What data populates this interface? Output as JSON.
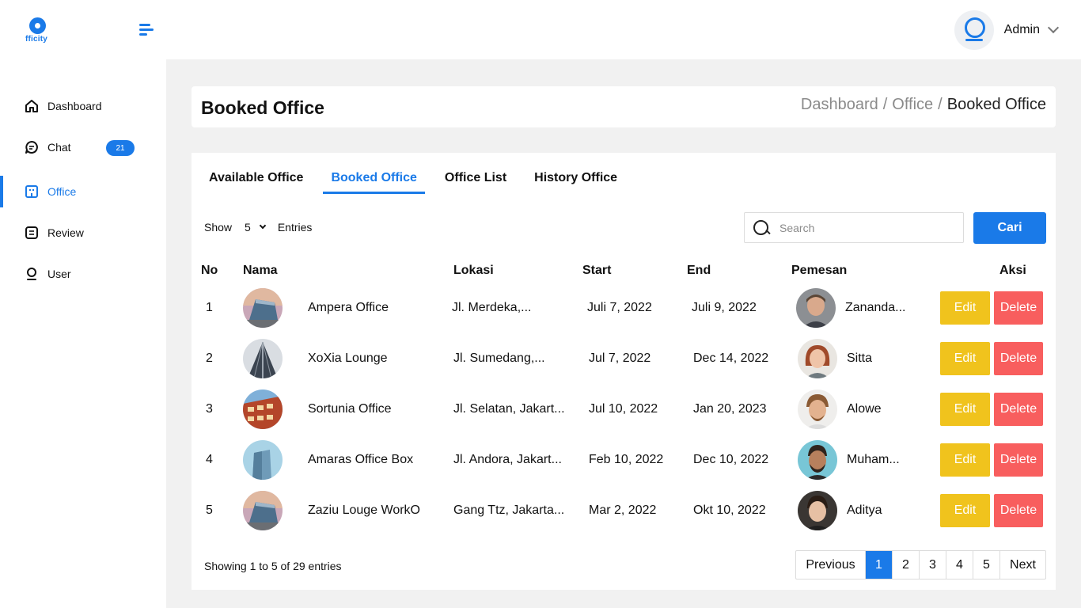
{
  "brand": {
    "name": "fficity",
    "color": "#1a7ae8"
  },
  "header": {
    "user_name": "Admin",
    "menu_icon": "menu-lines-icon",
    "avatar_icon": "user-avatar-icon"
  },
  "sidebar": {
    "items": [
      {
        "label": "Dashboard",
        "icon": "home-icon"
      },
      {
        "label": "Chat",
        "icon": "chat-icon",
        "badge": "21"
      },
      {
        "label": "Office",
        "icon": "office-icon",
        "active": true
      },
      {
        "label": "Review",
        "icon": "review-icon"
      },
      {
        "label": "User",
        "icon": "user-icon"
      }
    ]
  },
  "page": {
    "title": "Booked Office",
    "breadcrumb": [
      "Dashboard",
      "Office",
      "Booked Office"
    ],
    "breadcrumb_sep": "/"
  },
  "tabs": [
    {
      "label": "Available Office"
    },
    {
      "label": "Booked Office",
      "active": true
    },
    {
      "label": "Office List"
    },
    {
      "label": "History Office"
    }
  ],
  "controls": {
    "show_label": "Show",
    "entries_value": "5",
    "entries_label": "Entries",
    "search_placeholder": "Search",
    "search_button": "Cari"
  },
  "table": {
    "headers": [
      "No",
      "Nama",
      "Lokasi",
      "Start",
      "End",
      "Pemesan",
      "Aksi"
    ],
    "edit_label": "Edit",
    "delete_label": "Delete",
    "rows": [
      {
        "no": "1",
        "nama": "Ampera Office",
        "lokasi": "Jl. Merdeka,...",
        "start": "Juli 7, 2022",
        "end": "Juli 9, 2022",
        "pemesan": "Zananda..."
      },
      {
        "no": "2",
        "nama": "XoXia Lounge",
        "lokasi": "Jl. Sumedang,...",
        "start": "Jul 7, 2022",
        "end": "Dec 14, 2022",
        "pemesan": "Sitta"
      },
      {
        "no": "3",
        "nama": "Sortunia Office",
        "lokasi": "Jl. Selatan, Jakart...",
        "start": "Jul 10, 2022",
        "end": "Jan 20, 2023",
        "pemesan": "Alowe"
      },
      {
        "no": "4",
        "nama": "Amaras Office Box",
        "lokasi": "Jl. Andora, Jakart...",
        "start": "Feb 10, 2022",
        "end": "Dec 10, 2022",
        "pemesan": "Muham..."
      },
      {
        "no": "5",
        "nama": "Zaziu Louge WorkO",
        "lokasi": "Gang Ttz, Jakarta...",
        "start": "Mar 2, 2022",
        "end": "Okt 10, 2022",
        "pemesan": "Aditya"
      }
    ]
  },
  "footer": {
    "showing": "Showing 1 to 5 of 29 entries",
    "pager": [
      "Previous",
      "1",
      "2",
      "3",
      "4",
      "5",
      "Next"
    ],
    "current_page": "1"
  }
}
